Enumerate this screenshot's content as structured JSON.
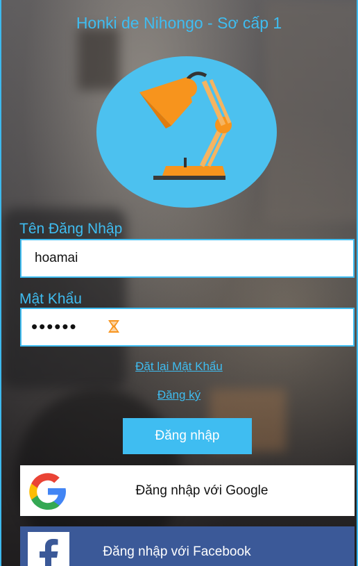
{
  "app": {
    "title": "Honki de Nihongo - Sơ cấp 1"
  },
  "login": {
    "username_label": "Tên Đăng Nhập",
    "username_value": "hoamai",
    "password_label": "Mật Khẩu",
    "password_masked": "••••••",
    "reset_link": "Đặt lại Mật Khẩu",
    "register_link": "Đăng ký",
    "login_button": "Đăng nhập"
  },
  "social": {
    "google_label": "Đăng nhập với Google",
    "facebook_label": "Đăng nhập với Facebook"
  },
  "colors": {
    "accent": "#3fbdf1",
    "logo_bg": "#4cc1ef",
    "lamp": "#f5a623",
    "facebook": "#3b5998"
  },
  "icons": {
    "logo": "desk-lamp-icon",
    "password_clear": "clear-icon",
    "google": "google-icon",
    "facebook": "facebook-icon"
  }
}
